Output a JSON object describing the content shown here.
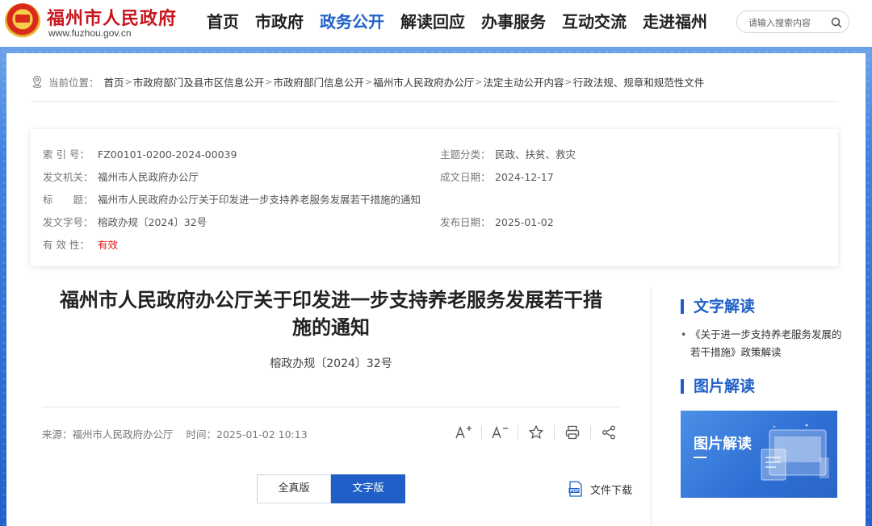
{
  "header": {
    "site_name": "福州市人民政府",
    "site_url": "www.fuzhou.gov.cn",
    "nav": [
      "首页",
      "市政府",
      "政务公开",
      "解读回应",
      "办事服务",
      "互动交流",
      "走进福州"
    ],
    "active_nav_index": 2,
    "search_placeholder": "请输入搜索内容"
  },
  "breadcrumb": {
    "label": "当前位置：",
    "items": [
      "首页",
      "市政府部门及县市区信息公开",
      "市政府部门信息公开",
      "福州市人民政府办公厅",
      "法定主动公开内容",
      "行政法规、规章和规范性文件"
    ],
    "separator": ">"
  },
  "info": {
    "index_label": "索 引 号：",
    "index_value": "FZ00101-0200-2024-00039",
    "topic_label": "主题分类：",
    "topic_value": "民政、扶贫、救灾",
    "issuer_label": "发文机关：",
    "issuer_value": "福州市人民政府办公厅",
    "written_label": "成文日期：",
    "written_value": "2024-12-17",
    "title_label": "标　　题：",
    "title_value": "福州市人民政府办公厅关于印发进一步支持养老服务发展若干措施的通知",
    "docno_label": "发文字号：",
    "docno_value": "榕政办规〔2024〕32号",
    "publish_label": "发布日期：",
    "publish_value": "2025-01-02",
    "validity_label": "有 效 性：",
    "validity_value": "有效"
  },
  "article": {
    "title_line1": "福州市人民政府办公厅关于印发进一步支持养老服务发展若干措",
    "title_line2": "施的通知",
    "doc_number": "榕政办规〔2024〕32号",
    "source": "来源：福州市人民政府办公厅",
    "time": "时间：2025-01-02 10:13",
    "tools": [
      "font-increase-icon",
      "font-decrease-icon",
      "star-icon",
      "print-icon",
      "share-icon"
    ],
    "view_buttons": [
      "全真版",
      "文字版"
    ],
    "active_view_index": 1,
    "download_label": "文件下载"
  },
  "sidebar": {
    "text_interp_title": "文字解读",
    "text_interp_link": "《关于进一步支持养老服务发展的若干措施》政策解读",
    "pic_interp_title": "图片解读",
    "pic_card_title": "图片解读"
  },
  "colors": {
    "brand_red": "#c9151e",
    "accent_blue": "#1f5fc7",
    "valid_red": "#e31515"
  }
}
